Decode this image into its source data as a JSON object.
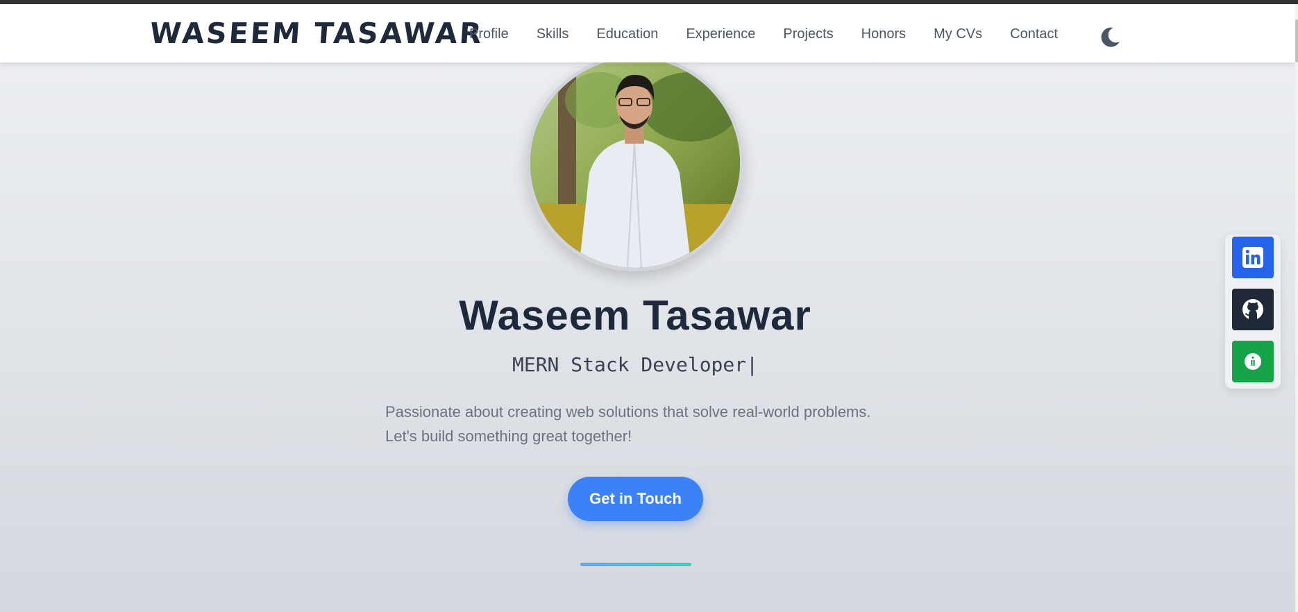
{
  "header": {
    "logo": "WASEEM TASAWAR",
    "nav": [
      "Profile",
      "Skills",
      "Education",
      "Experience",
      "Projects",
      "Honors",
      "My CVs",
      "Contact"
    ],
    "theme_toggle_icon": "moon-icon"
  },
  "hero": {
    "avatar_icon": "profile-photo",
    "name": "Waseem Tasawar",
    "role": "MERN Stack Developer",
    "caret": "|",
    "tagline_line1": "Passionate about creating web solutions that solve real-world problems.",
    "tagline_line2": "Let's build something great together!",
    "cta_label": "Get in Touch"
  },
  "social": [
    {
      "name": "linkedin",
      "icon": "linkedin-icon",
      "color": "#2563eb"
    },
    {
      "name": "github",
      "icon": "github-icon",
      "color": "#1f2937"
    },
    {
      "name": "info",
      "icon": "info-icon",
      "color": "#16a34a"
    }
  ],
  "colors": {
    "accent": "#3b82f6",
    "text_dark": "#1e293b",
    "divider_start": "#60a5fa",
    "divider_end": "#2dd4bf"
  }
}
